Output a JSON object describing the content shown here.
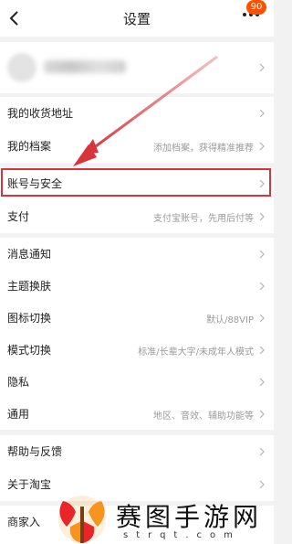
{
  "header": {
    "title": "设置",
    "badge": "90"
  },
  "sections": {
    "addresses": {
      "label": "我的收货地址"
    },
    "profile_file": {
      "label": "我的档案",
      "hint": "添加档案，获得精准推荐"
    },
    "account_security": {
      "label": "账号与安全"
    },
    "payment": {
      "label": "支付",
      "hint": "支付宝账号，先用后付等"
    },
    "notifications": {
      "label": "消息通知"
    },
    "themes": {
      "label": "主题换肤"
    },
    "icon_switch": {
      "label": "图标切换",
      "hint": "默认/88VIP"
    },
    "mode_switch": {
      "label": "模式切换",
      "hint": "标准/长辈大字/未成年人模式"
    },
    "privacy": {
      "label": "隐私"
    },
    "general": {
      "label": "通用",
      "hint": "地区、音效、辅助功能等"
    },
    "help": {
      "label": "帮助与反馈"
    },
    "about": {
      "label": "关于淘宝"
    },
    "merchant": {
      "label": "商家入"
    }
  },
  "watermark": {
    "text": "赛图手游网",
    "sub": "strqt.com"
  },
  "colors": {
    "accent": "#ff5000",
    "highlight": "#d9333b",
    "watermark_orange": "#f7941d",
    "watermark_red": "#e8262a"
  }
}
